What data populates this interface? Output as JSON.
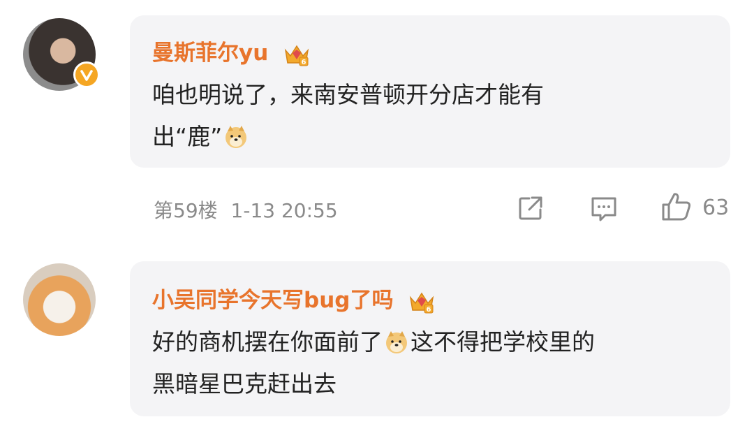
{
  "comments": [
    {
      "username": "曼斯菲尔yu",
      "text_line1": "咱也明说了，来南安普顿开分店才能有",
      "text_line2_pre": "出“鹿”",
      "floor": "第59楼",
      "datetime": "1-13 20:55",
      "likes": "63",
      "verified": true
    },
    {
      "username": "小吴同学今天写bug了吗",
      "text_line1_pre": "好的商机摆在你面前了",
      "text_line1_post": "这不得把学校里的",
      "text_line2": "黑暗星巴克赶出去"
    }
  ],
  "icons": [
    "crown-badge-icon",
    "doge-emoji-icon",
    "share-icon",
    "comment-icon",
    "like-icon",
    "verified-icon"
  ],
  "colors": {
    "username": "#e8742c",
    "bubble": "#f4f4f6",
    "meta": "#8a8a8a",
    "verified": "#f5a623"
  }
}
